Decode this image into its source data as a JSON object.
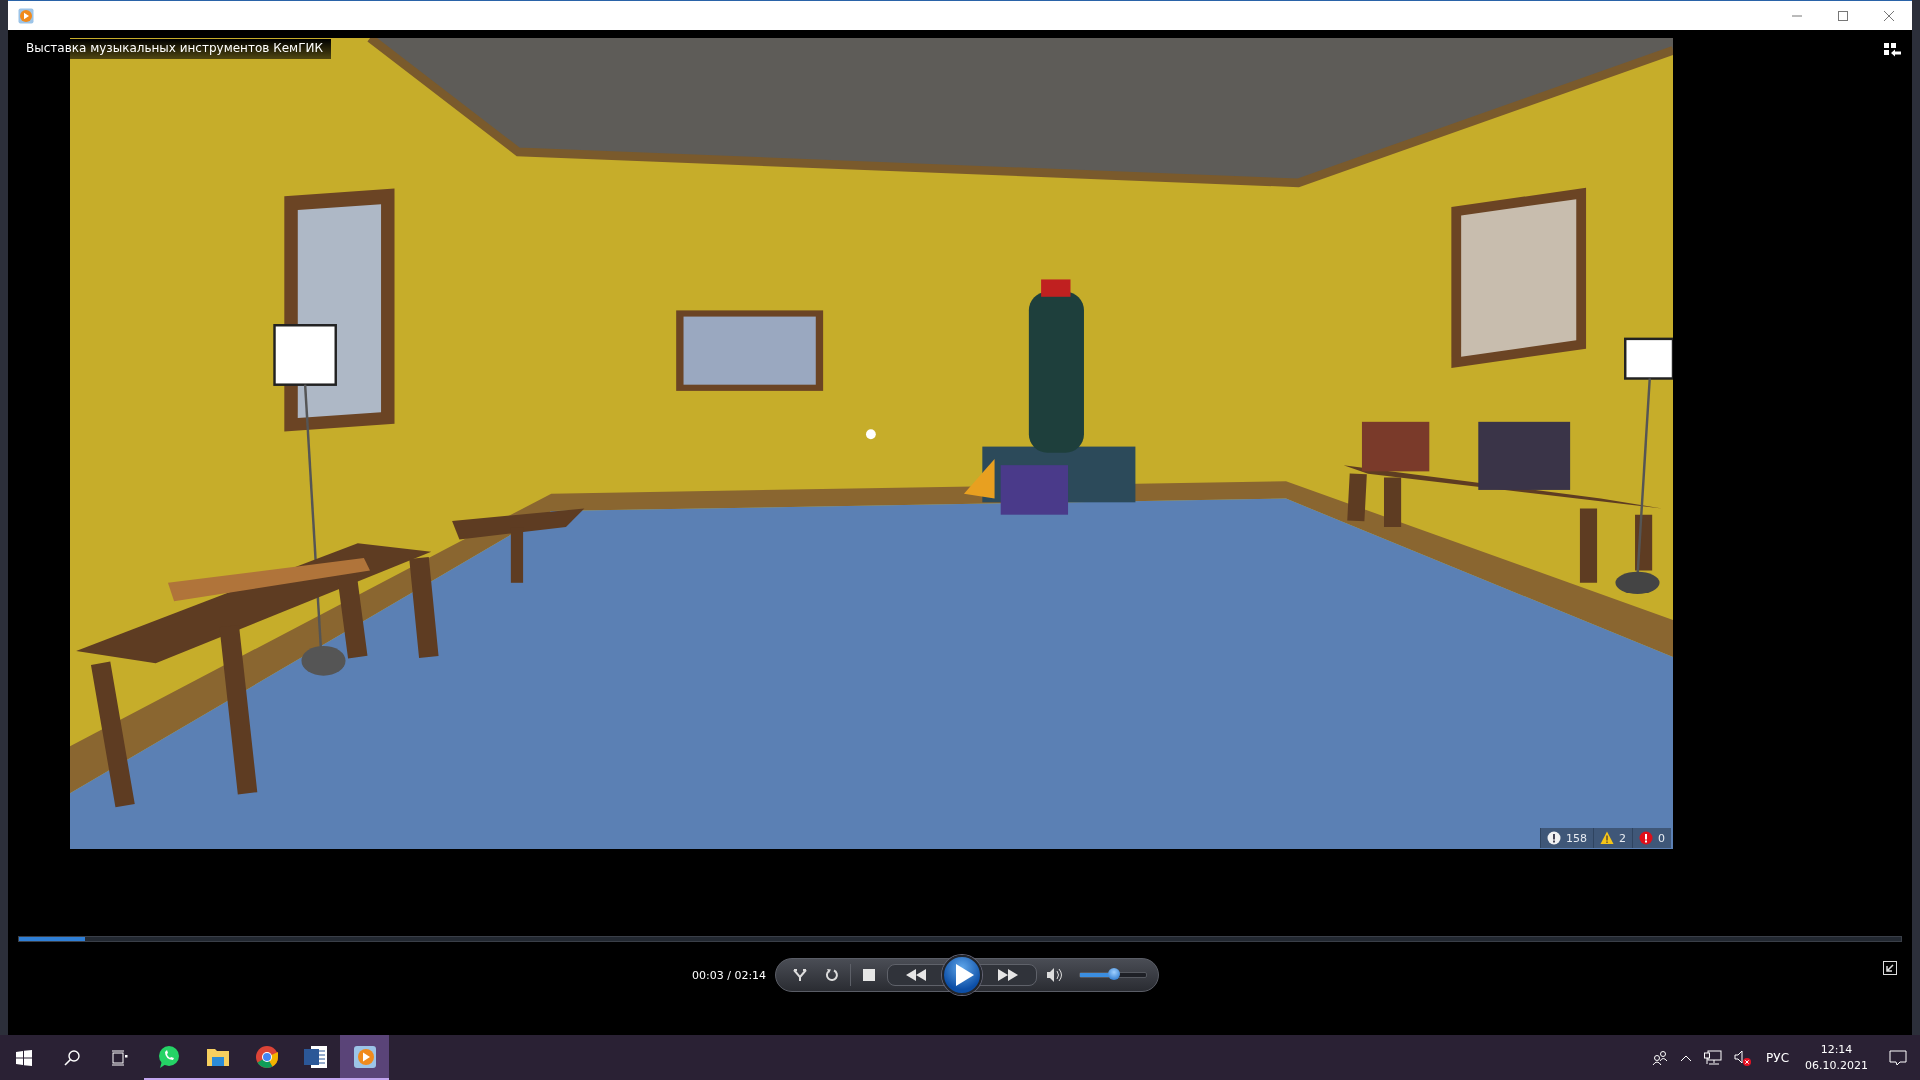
{
  "video": {
    "title": "Выставка музыкальных инструментов КемГИК",
    "stats": [
      {
        "kind": "info",
        "count": "158"
      },
      {
        "kind": "warning",
        "count": "2"
      },
      {
        "kind": "error",
        "count": "0"
      }
    ]
  },
  "player": {
    "progress": {
      "level": 0.035
    },
    "time": "00:03 / 02:14",
    "volume": {
      "level": 0.52
    }
  },
  "taskbar": {
    "apps": [
      {
        "kind": "whatsapp",
        "selected": false
      },
      {
        "kind": "folder",
        "selected": false
      },
      {
        "kind": "chrome",
        "selected": false
      },
      {
        "kind": "word",
        "selected": false
      },
      {
        "kind": "player",
        "selected": true
      }
    ],
    "language": "РУС",
    "time": "12:14",
    "date": "06.10.2021"
  }
}
